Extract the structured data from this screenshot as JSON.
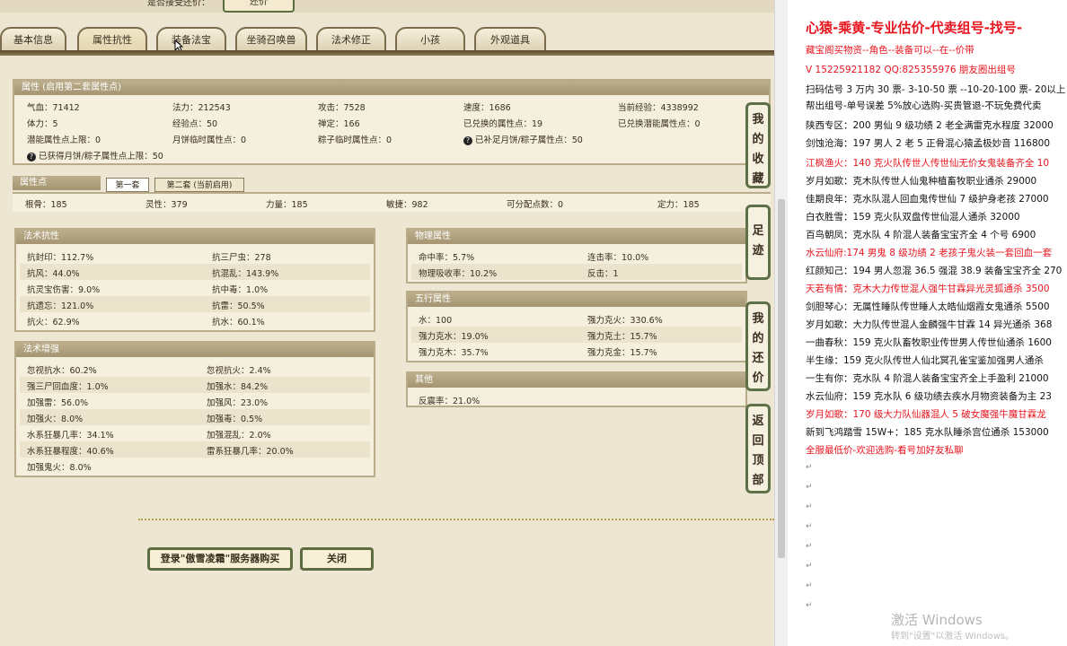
{
  "top": {
    "label": "是否接受还价：",
    "button": "还价"
  },
  "tabs": [
    "基本信息",
    "属性抗性",
    "装备法宝",
    "坐骑召唤兽",
    "法术修正",
    "小孩",
    "外观道具"
  ],
  "attr_panel": {
    "title": "属性 (启用第二套属性点)",
    "cells": [
      "气血：71412",
      "法力：212543",
      "攻击：7528",
      "速度：1686",
      "当前经验：4338992",
      "体力：5",
      "经验点：50",
      "禅定：166",
      "已兑换的属性点：19",
      "已兑换潜能属性点：0",
      "潜能属性点上限：0",
      "月饼临时属性点：0",
      "粽子临时属性点：0",
      "已补足月饼/粽子属性点：50",
      "已获得月饼/粽子属性点上限：50"
    ]
  },
  "points_panel": {
    "title": "属性点",
    "subtabs": [
      "第一套",
      "第二套 (当前启用)"
    ],
    "cells": [
      "根骨：185",
      "灵性：379",
      "力量：185",
      "敏捷：982",
      "可分配点数：0",
      "定力：185"
    ]
  },
  "resist_panel": {
    "title": "法术抗性",
    "rows": [
      [
        "抗封印：112.7%",
        "抗三尸虫：278"
      ],
      [
        "抗风：44.0%",
        "抗混乱：143.9%"
      ],
      [
        "抗灵宝伤害：9.0%",
        "抗中毒：1.0%"
      ],
      [
        "抗遗忘：121.0%",
        "抗雷：50.5%"
      ],
      [
        "抗火：62.9%",
        "抗水：60.1%"
      ]
    ]
  },
  "boost_panel": {
    "title": "法术增强",
    "rows": [
      [
        "忽视抗水：60.2%",
        "忽视抗火：2.4%"
      ],
      [
        "强三尸回血度：1.0%",
        "加强水：84.2%"
      ],
      [
        "加强雷：56.0%",
        "加强风：23.0%"
      ],
      [
        "加强火：8.0%",
        "加强毒：0.5%"
      ],
      [
        "水系狂暴几率：34.1%",
        "加强混乱：2.0%"
      ],
      [
        "水系狂暴程度：40.6%",
        "雷系狂暴几率：20.0%"
      ],
      [
        "加强鬼火：8.0%",
        ""
      ]
    ]
  },
  "phys_panel": {
    "title": "物理属性",
    "rows": [
      [
        "命中率：5.7%",
        "连击率：10.0%"
      ],
      [
        "物理吸收率：10.2%",
        "反击：1"
      ]
    ]
  },
  "five_panel": {
    "title": "五行属性",
    "rows": [
      [
        "水：100",
        "强力克火：330.6%"
      ],
      [
        "强力克水：19.0%",
        "强力克土：15.7%"
      ],
      [
        "强力克木：35.7%",
        "强力克金：15.7%"
      ]
    ]
  },
  "other_panel": {
    "title": "其他",
    "rows": [
      [
        "反震率：21.0%"
      ]
    ]
  },
  "side_tabs": [
    "我的收藏",
    "足迹",
    "我的还价",
    "返回顶部"
  ],
  "bottom": {
    "login": "登录\"傲雪凌霜\"服务器购买",
    "close": "关闭"
  },
  "doc": {
    "lines": [
      {
        "t": "心猿-乘黄-专业估价-代卖组号-找号-",
        "c": "red big"
      },
      {
        "t": "藏宝阁买物资--角色--装备可以--在--价带",
        "c": "red"
      },
      {
        "t": "V 15225921182 QQ:825355976 朋友圈出组号",
        "c": "red"
      },
      {
        "t": "扫码估号 3 万内 30 票- 3-10-50 票  --10-20-100 票- 20以上",
        "c": ""
      },
      {
        "t": "帮出组号-单号误差 5%放心选购-买贵管退-不玩免费代卖",
        "c": ""
      },
      {
        "t": "陕西专区：200 男仙 9 级功绩 2 老全满雷克水程度 32000",
        "c": ""
      },
      {
        "t": "剑蚀沧海：197 男人 2 老 5 正骨混心猿孟极妙音 116800",
        "c": ""
      },
      {
        "t": "江枫渔火：140 克火队传世人传世仙无价女鬼装备齐全 10",
        "c": "red"
      },
      {
        "t": "岁月如歌：克木队传世人仙鬼种植畜牧职业通杀 29000",
        "c": ""
      },
      {
        "t": "佳期良年：克水队混人回血鬼传世仙 7 级护身老孩 27000",
        "c": ""
      },
      {
        "t": "白衣胜雪：159 克火队双盘传世仙混人通杀 32000",
        "c": ""
      },
      {
        "t": "百鸟朝凤：克水队 4 阶混人装备宝宝齐全 4 个号 6900",
        "c": ""
      },
      {
        "t": "水云仙府:174 男鬼 8 级功绩 2 老孩子鬼火装一套回血一套",
        "c": "red"
      },
      {
        "t": "红颜知己：194 男人忽混 36.5 强混 38.9 装备宝宝齐全 270",
        "c": ""
      },
      {
        "t": "天若有情：克木大力传世混人强牛甘霖异光灵狐通杀 3500",
        "c": "red"
      },
      {
        "t": "剑胆琴心：无属性睡队传世睡人太皓仙烟霞女鬼通杀 5500",
        "c": ""
      },
      {
        "t": "岁月如歌：大力队传世混人金麟强牛甘霖 14 异光通杀 368",
        "c": ""
      },
      {
        "t": "一曲春秋：159 克火队畜牧职业传世男人传世仙通杀 1600",
        "c": ""
      },
      {
        "t": "半生缘：159 克火队传世人仙北冥孔雀宝鉴加强男人通杀",
        "c": ""
      },
      {
        "t": "一生有你：克水队 4 阶混人装备宝宝齐全上手盈利 21000",
        "c": ""
      },
      {
        "t": "水云仙府：159 克水队 6 级功绩去疾水月物资装备为主 23",
        "c": ""
      },
      {
        "t": "岁月如歌：170 级大力队仙器混人 5 破女魔强牛魔甘霖龙",
        "c": "red"
      },
      {
        "t": "新到飞鸿踏雪 15W+：185 克水队睡杀宫位通杀 153000",
        "c": ""
      },
      {
        "t": "全服最低价-欢迎选购-看号加好友私聊",
        "c": "red"
      }
    ],
    "watermark": "激活 Windows",
    "watermark_sub": "转到\"设置\"以激活 Windows。"
  }
}
